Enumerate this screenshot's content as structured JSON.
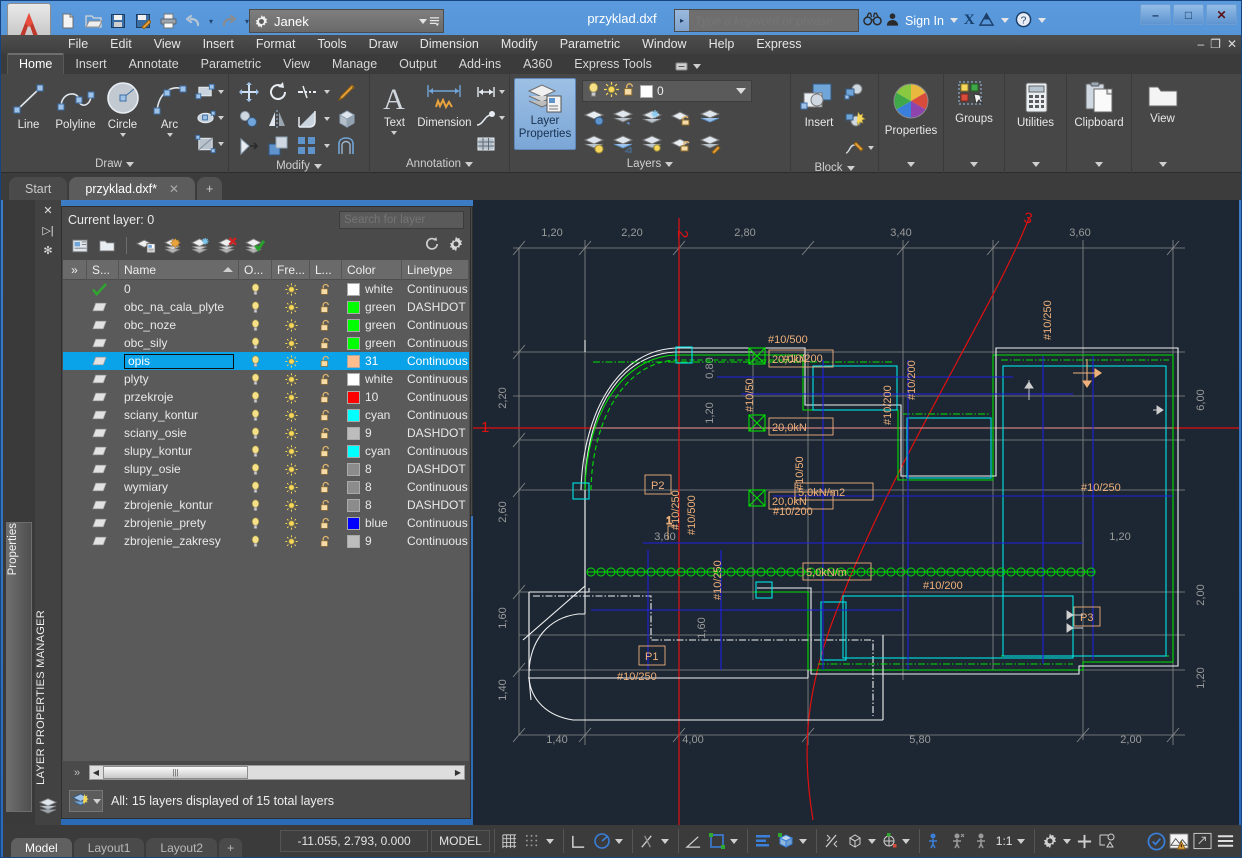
{
  "window": {
    "document_title": "przyklad.dxf",
    "workspace": "Janek",
    "minimize": "–",
    "maximize": "□",
    "close": "✕"
  },
  "quick_access": [
    {
      "name": "new-icon",
      "label": "New"
    },
    {
      "name": "open-icon",
      "label": "Open"
    },
    {
      "name": "save-icon",
      "label": "Save"
    },
    {
      "name": "saveas-icon",
      "label": "Save As"
    },
    {
      "name": "plot-icon",
      "label": "Plot"
    },
    {
      "name": "undo-icon",
      "label": "Undo"
    },
    {
      "name": "redo-icon",
      "label": "Redo"
    }
  ],
  "search": {
    "placeholder": "Type a keyword or phrase",
    "sign_in": "Sign In"
  },
  "menu": {
    "items": [
      "File",
      "Edit",
      "View",
      "Insert",
      "Format",
      "Tools",
      "Draw",
      "Dimension",
      "Modify",
      "Parametric",
      "Window",
      "Help",
      "Express"
    ]
  },
  "ribbon": {
    "tabs": [
      {
        "label": "Home",
        "active": true
      },
      {
        "label": "Insert",
        "active": false
      },
      {
        "label": "Annotate",
        "active": false
      },
      {
        "label": "Parametric",
        "active": false
      },
      {
        "label": "View",
        "active": false
      },
      {
        "label": "Manage",
        "active": false
      },
      {
        "label": "Output",
        "active": false
      },
      {
        "label": "Add-ins",
        "active": false
      },
      {
        "label": "A360",
        "active": false
      },
      {
        "label": "Express Tools",
        "active": false
      }
    ],
    "panels": [
      {
        "title": "Draw",
        "buttons": [
          "Line",
          "Polyline",
          "Circle",
          "Arc"
        ]
      },
      {
        "title": "Modify",
        "buttons": []
      },
      {
        "title": "Annotation",
        "buttons": [
          "Text",
          "Dimension"
        ]
      },
      {
        "title": "Layers",
        "buttons": [
          "Layer Properties"
        ]
      },
      {
        "title": "Block",
        "buttons": [
          "Insert"
        ]
      },
      {
        "title": "Properties",
        "buttons": [
          "Properties"
        ]
      },
      {
        "title": "Groups",
        "buttons": [
          "Groups"
        ]
      },
      {
        "title": "Utilities",
        "buttons": [
          "Utilities"
        ]
      },
      {
        "title": "Clipboard",
        "buttons": [
          "Clipboard"
        ]
      },
      {
        "title": "View",
        "buttons": [
          "View"
        ]
      }
    ],
    "labels": {
      "line": "Line",
      "polyline": "Polyline",
      "circle": "Circle",
      "arc": "Arc",
      "text": "Text",
      "dimension": "Dimension",
      "layer_properties_1": "Layer",
      "layer_properties_2": "Properties",
      "insert": "Insert",
      "properties": "Properties",
      "groups": "Groups",
      "utilities": "Utilities",
      "clipboard": "Clipboard",
      "view": "View",
      "draw": "Draw",
      "modify": "Modify",
      "annotation": "Annotation",
      "layers": "Layers",
      "block": "Block"
    },
    "layer_control": {
      "current_layer": "0",
      "color": "#ffffff"
    }
  },
  "doc_tabs": [
    {
      "label": "Start",
      "active": false,
      "closable": false
    },
    {
      "label": "przyklad.dxf*",
      "active": true,
      "closable": true
    }
  ],
  "doc_tabs_add": "+",
  "palettes": {
    "layer_properties_manager": "Layer Properties Manager",
    "properties": "Properties",
    "anchored_label": "LAYER PROPERTIES MANAGER"
  },
  "layer_manager": {
    "current_layer_text": "Current layer: 0",
    "search_placeholder": "Search for layer",
    "columns": [
      "S...",
      "Name",
      "O...",
      "Fre...",
      "L...",
      "Color",
      "Linetype"
    ],
    "status_text": "All: 15 layers displayed of 15 total layers",
    "selected_layer": "opis",
    "rows": [
      {
        "name": "0",
        "status": "current",
        "color_name": "white",
        "color_hex": "#ffffff",
        "linetype": "Continuous"
      },
      {
        "name": "obc_na_cala_plyte",
        "status": "layer",
        "color_name": "green",
        "color_hex": "#00ff00",
        "linetype": "DASHDOT"
      },
      {
        "name": "obc_noze",
        "status": "layer",
        "color_name": "green",
        "color_hex": "#00ff00",
        "linetype": "Continuous"
      },
      {
        "name": "obc_sily",
        "status": "layer",
        "color_name": "green",
        "color_hex": "#00ff00",
        "linetype": "Continuous"
      },
      {
        "name": "opis",
        "status": "layer",
        "color_name": "31",
        "color_hex": "#ffbc8c",
        "linetype": "Continuous"
      },
      {
        "name": "plyty",
        "status": "layer",
        "color_name": "white",
        "color_hex": "#ffffff",
        "linetype": "Continuous"
      },
      {
        "name": "przekroje",
        "status": "layer",
        "color_name": "10",
        "color_hex": "#ff0000",
        "linetype": "Continuous"
      },
      {
        "name": "sciany_kontur",
        "status": "layer",
        "color_name": "cyan",
        "color_hex": "#00ffff",
        "linetype": "Continuous"
      },
      {
        "name": "sciany_osie",
        "status": "layer",
        "color_name": "9",
        "color_hex": "#bdbdbd",
        "linetype": "DASHDOT"
      },
      {
        "name": "slupy_kontur",
        "status": "layer",
        "color_name": "cyan",
        "color_hex": "#00ffff",
        "linetype": "Continuous"
      },
      {
        "name": "slupy_osie",
        "status": "layer",
        "color_name": "8",
        "color_hex": "#8c8c8c",
        "linetype": "DASHDOT"
      },
      {
        "name": "wymiary",
        "status": "layer",
        "color_name": "8",
        "color_hex": "#8c8c8c",
        "linetype": "Continuous"
      },
      {
        "name": "zbrojenie_kontur",
        "status": "layer",
        "color_name": "8",
        "color_hex": "#8c8c8c",
        "linetype": "DASHDOT"
      },
      {
        "name": "zbrojenie_prety",
        "status": "layer",
        "color_name": "blue",
        "color_hex": "#0000ff",
        "linetype": "Continuous"
      },
      {
        "name": "zbrojenie_zakresy",
        "status": "layer",
        "color_name": "9",
        "color_hex": "#bdbdbd",
        "linetype": "Continuous"
      }
    ]
  },
  "drawing": {
    "top_dimensions": [
      "1,20",
      "2,20",
      "2,80",
      "3,40",
      "3,60"
    ],
    "bottom_dimensions": [
      "1,40",
      "4,00",
      "5,80",
      "2,00"
    ],
    "left_dimensions": [
      "2,20",
      "2,60",
      "1,60",
      "1,40"
    ],
    "right_dimensions": [
      "6,00",
      "2,00",
      "1,20"
    ],
    "inner_dimensions": [
      "0,80",
      "1,20",
      "1,60",
      "3,60",
      "1,20"
    ],
    "axis_labels": [
      "1",
      "2",
      "3"
    ],
    "annotations": [
      "#10/500",
      "#10/200",
      "#10/250",
      "#10/200",
      "#10/200",
      "#10/250",
      "#10/50",
      "#10/50",
      "#10/500",
      "#10/250",
      "#10/250",
      "#10/250",
      "#10/200",
      "20,0kN",
      "20,0kN",
      "20,0kN",
      "5,0kN/m2",
      "5,0kN/m",
      "P1",
      "P2",
      "P3"
    ],
    "colors": {
      "background": "#1c2733",
      "white": "#f0f0f0",
      "green": "#00e000",
      "cyan": "#00e6e6",
      "blue": "#2020e0",
      "red": "#e01010",
      "orange": "#f0b07a",
      "gray": "#9a9a9a"
    }
  },
  "status_bar": {
    "layout_tabs": [
      "Model",
      "Layout1",
      "Layout2"
    ],
    "layout_add": "+",
    "coordinates": "-11.055, 2.793, 0.000",
    "space": "MODEL",
    "scale": "1:1"
  }
}
